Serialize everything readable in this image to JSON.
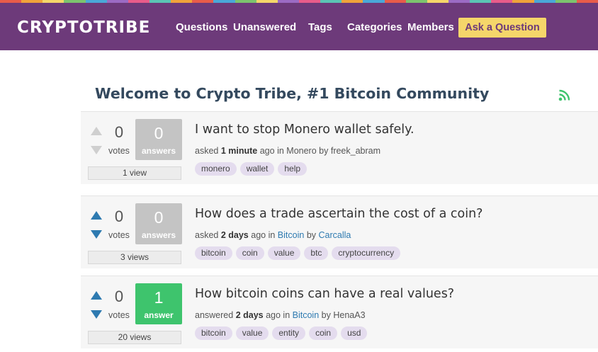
{
  "stripe_colors": [
    "#e85c4a",
    "#f0a33b",
    "#f5d66a",
    "#7cc36e",
    "#4aa8d8",
    "#9b6bc4",
    "#e85c8a",
    "#5bc4b4",
    "#f0a33b",
    "#e85c4a",
    "#4aa8d8",
    "#7cc36e",
    "#f5d66a",
    "#9b6bc4",
    "#e85c8a",
    "#5bc4b4",
    "#f0a33b",
    "#4aa8d8",
    "#e85c4a",
    "#7cc36e",
    "#f5d66a",
    "#9b6bc4",
    "#5bc4b4",
    "#e85c8a",
    "#f0a33b",
    "#4aa8d8",
    "#7cc36e",
    "#e85c4a"
  ],
  "header": {
    "logo": "CRYPTOTRIBE",
    "nav": [
      "Questions",
      "Unanswered",
      "Tags",
      "Categories",
      "Members"
    ],
    "ask_button": "Ask a Question"
  },
  "page_title": "Welcome to Crypto Tribe, #1 Bitcoin Community",
  "rss_icon": "rss-icon",
  "questions": [
    {
      "votes": "0",
      "votes_label": "votes",
      "answers": "0",
      "answers_label": "answers",
      "views": "1 view",
      "title": "I want to stop Monero wallet safely.",
      "meta_action": "asked",
      "meta_time": "1 minute",
      "meta_ago": "ago in",
      "category": "Monero",
      "by": "by",
      "author": "freek_abram",
      "tags": [
        "monero",
        "wallet",
        "help"
      ]
    },
    {
      "votes": "0",
      "votes_label": "votes",
      "answers": "0",
      "answers_label": "answers",
      "views": "3 views",
      "title": "How does a trade ascertain the cost of a coin?",
      "meta_action": "asked",
      "meta_time": "2 days",
      "meta_ago": "ago in",
      "category": "Bitcoin",
      "by": "by",
      "author": "Carcalla",
      "tags": [
        "bitcoin",
        "coin",
        "value",
        "btc",
        "cryptocurrency"
      ]
    },
    {
      "votes": "0",
      "votes_label": "votes",
      "answers": "1",
      "answers_label": "answer",
      "views": "20 views",
      "title": "How bitcoin coins can have a real values?",
      "meta_action": "answered",
      "meta_time": "2 days",
      "meta_ago": "ago in",
      "category": "Bitcoin",
      "by": "by",
      "author": "HenaA3",
      "tags": [
        "bitcoin",
        "value",
        "entity",
        "coin",
        "usd"
      ]
    }
  ],
  "colors": {
    "header_bg": "#6d3a7a",
    "ask_button_bg": "#f5d66a",
    "vote_arrow_active": "#2e7ab0",
    "vote_arrow_inactive": "#cfcfcf",
    "answered_box": "#3ec46d",
    "unanswered_box": "#c4c4c4",
    "tag_bg": "#e4dcee",
    "rss": "#3ec46d"
  }
}
